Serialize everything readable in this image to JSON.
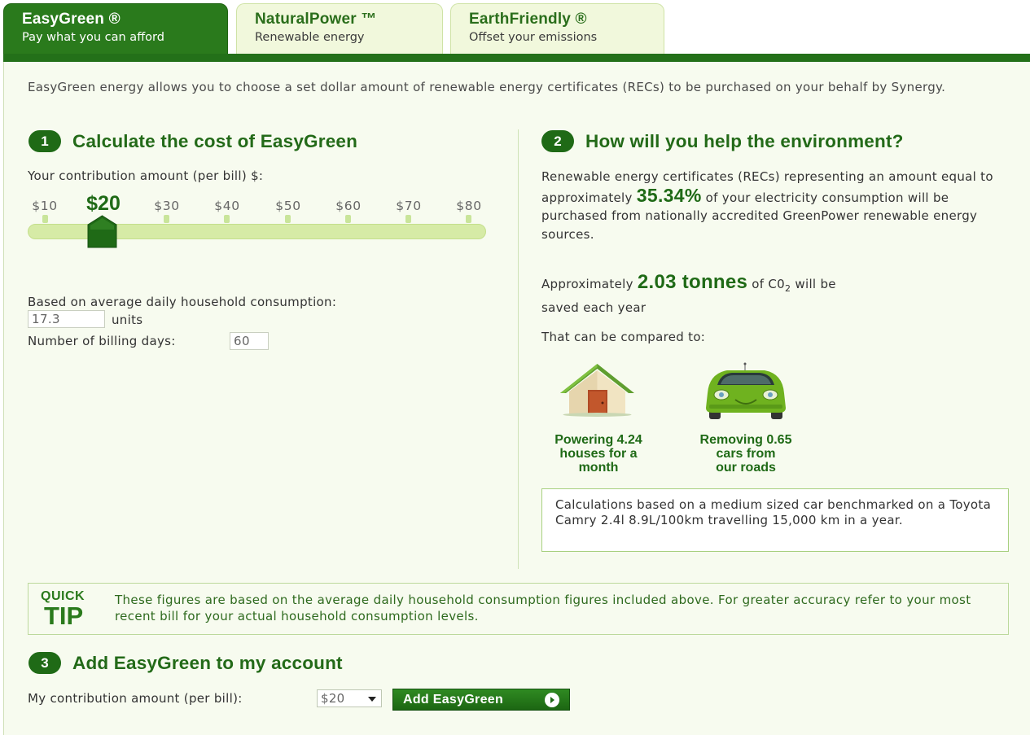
{
  "tabs": [
    {
      "title": "EasyGreen ®",
      "subtitle": "Pay what you can afford"
    },
    {
      "title": "NaturalPower ™",
      "subtitle": "Renewable energy"
    },
    {
      "title": "EarthFriendly ®",
      "subtitle": "Offset your emissions"
    }
  ],
  "intro": "EasyGreen energy allows you to choose a set dollar amount of renewable energy certificates (RECs) to be purchased on your behalf by Synergy.",
  "step1": {
    "number": "1",
    "title": "Calculate the cost of EasyGreen",
    "contribution_label": "Your contribution amount (per bill) $:",
    "slider_options": [
      "$10",
      "$20",
      "$30",
      "$40",
      "$50",
      "$60",
      "$70",
      "$80"
    ],
    "selected_value": "$20",
    "consumption_label": "Based on average daily household consumption:",
    "consumption_value": "17.3",
    "units_label": "units",
    "billing_days_label": "Number of billing days:",
    "billing_days_value": "60"
  },
  "step2": {
    "number": "2",
    "title": "How will you help the environment?",
    "rec_text_1": "Renewable energy certificates (RECs) representing an amount equal to approximately",
    "rec_percent": "35.34%",
    "rec_text_2": "of your electricity consumption will be purchased from nationally accredited GreenPower renewable energy sources.",
    "co2_prefix": "Approximately",
    "co2_value": "2.03 tonnes",
    "co2_suffix_1": "of C0",
    "co2_sub": "2",
    "co2_suffix_2": "will be",
    "co2_suffix_3": "saved each year",
    "compare_label": "That can be compared to:",
    "houses": {
      "icon": "house-icon",
      "line1": "Powering 4.24",
      "line2": "houses for a",
      "line3": "month"
    },
    "cars": {
      "icon": "car-icon",
      "line1": "Removing 0.65",
      "line2": "cars from",
      "line3": "our roads"
    },
    "note": "Calculations based on a medium sized car benchmarked on a Toyota Camry 2.4l 8.9L/100km travelling 15,000 km in a year."
  },
  "tip": {
    "quick": "QUICK",
    "tip": "TIP",
    "text": "These figures are based on the average daily household consumption figures included above. For greater accuracy refer to your most recent bill for your actual household consumption levels."
  },
  "step3": {
    "number": "3",
    "title": "Add EasyGreen to my account",
    "contribution_label": "My contribution amount (per bill):",
    "select_value": "$20",
    "button_label": "Add EasyGreen"
  },
  "colors": {
    "brand_green": "#1f6a16",
    "tab_green": "#2a7a1c",
    "panel_bg": "#f7fbef",
    "slider_track": "#d6eba6"
  }
}
